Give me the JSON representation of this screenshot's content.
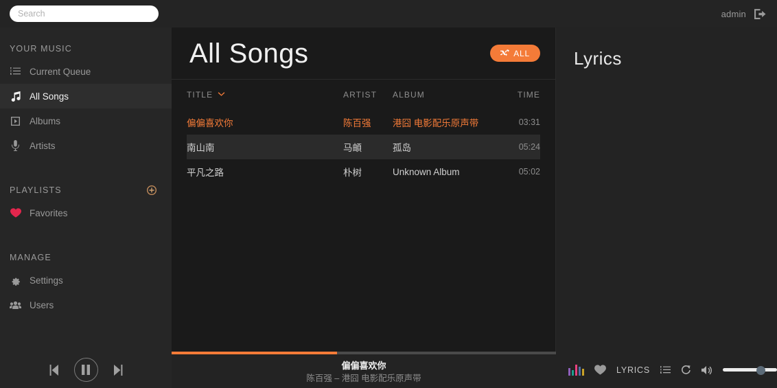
{
  "topbar": {
    "search_placeholder": "Search",
    "search_value": "",
    "username": "admin"
  },
  "sidebar": {
    "section_your_music": "YOUR MUSIC",
    "section_playlists": "PLAYLISTS",
    "section_manage": "MANAGE",
    "your_music_items": [
      {
        "label": "Current Queue",
        "icon": "list-ol-icon",
        "active": false
      },
      {
        "label": "All Songs",
        "icon": "music-note-icon",
        "active": true
      },
      {
        "label": "Albums",
        "icon": "album-play-icon",
        "active": false
      },
      {
        "label": "Artists",
        "icon": "microphone-icon",
        "active": false
      }
    ],
    "playlist_items": [
      {
        "label": "Favorites",
        "icon": "heart-icon",
        "color": "#e2264d"
      }
    ],
    "manage_items": [
      {
        "label": "Settings",
        "icon": "gear-icon"
      },
      {
        "label": "Users",
        "icon": "users-icon"
      }
    ],
    "add_playlist_icon": "plus-circle-icon"
  },
  "main": {
    "page_title": "All Songs",
    "shuffle_button": {
      "label": "ALL",
      "icon": "shuffle-icon",
      "color": "#f47b38"
    },
    "columns": {
      "title": "TITLE",
      "artist": "ARTIST",
      "album": "ALBUM",
      "time": "TIME"
    },
    "sort": {
      "column": "TITLE",
      "direction": "down",
      "icon": "chevron-down-icon"
    },
    "songs": [
      {
        "title": "偏偏喜欢你",
        "artist": "陈百强",
        "album": "港囧 电影配乐原声带",
        "time": "03:31",
        "state": "playing"
      },
      {
        "title": "南山南",
        "artist": "马頔",
        "album": "孤岛",
        "time": "05:24",
        "state": "selected"
      },
      {
        "title": "平凡之路",
        "artist": "朴树",
        "album": "Unknown Album",
        "time": "05:02",
        "state": "normal"
      }
    ]
  },
  "lyrics_panel": {
    "title": "Lyrics",
    "content": ""
  },
  "player": {
    "prev_icon": "step-backward-icon",
    "play_pause_icon": "pause-icon",
    "next_icon": "step-forward-icon",
    "progress_percent": 43,
    "now_playing_title": "偏偏喜欢你",
    "now_playing_subtitle": "陈百强 – 港囧 电影配乐原声带",
    "equalizer_icon": "equalizer-icon",
    "equalizer_colors": [
      "#8e5fbb",
      "#1f9e8f",
      "#e8417f",
      "#4a6fa5",
      "#c9a227"
    ],
    "favorite_icon": "heart-icon",
    "lyrics_label": "LYRICS",
    "queue_icon": "list-ol-icon",
    "repeat_icon": "repeat-icon",
    "volume_icon": "volume-up-icon",
    "volume_percent": 70
  },
  "colors": {
    "accent": "#f47b38",
    "sidebar_bg": "#262626",
    "main_bg": "#1a1a1a",
    "panel_bg": "#232323",
    "favorite_red": "#e2264d"
  }
}
